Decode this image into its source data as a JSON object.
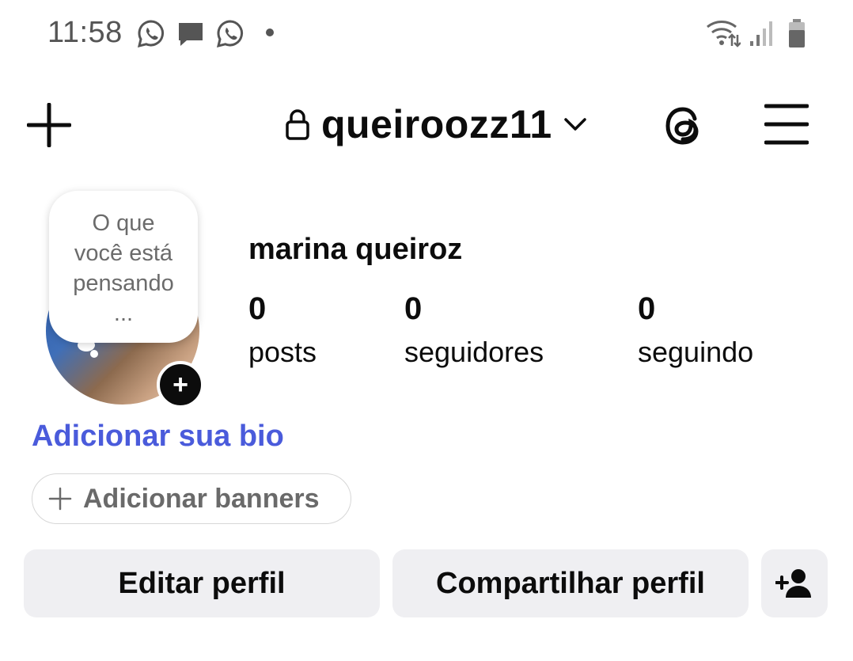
{
  "status_bar": {
    "time": "11:58",
    "notification_icons": [
      "whatsapp-icon",
      "message-icon",
      "whatsapp-icon"
    ],
    "system_icons": [
      "wifi-icon",
      "signal-icon",
      "battery-icon"
    ]
  },
  "header": {
    "username": "queiroozz11",
    "icons": [
      "plus-icon",
      "lock-icon",
      "chevron-down-icon",
      "threads-icon",
      "menu-icon"
    ]
  },
  "profile": {
    "note_bubble": [
      "O que",
      "você está",
      "pensando",
      "..."
    ],
    "full_name": "marina queiroz",
    "stats": [
      {
        "value": "0",
        "label": "posts"
      },
      {
        "value": "0",
        "label": "seguidores"
      },
      {
        "value": "0",
        "label": "seguindo"
      }
    ],
    "bio_link": "Adicionar sua bio",
    "banner_button": "Adicionar banners"
  },
  "actions": {
    "edit_profile": "Editar perfil",
    "share_profile": "Compartilhar perfil"
  },
  "colors": {
    "link": "#4a5bdb",
    "button_bg": "#efeff2",
    "text": "#0c0c0c"
  }
}
